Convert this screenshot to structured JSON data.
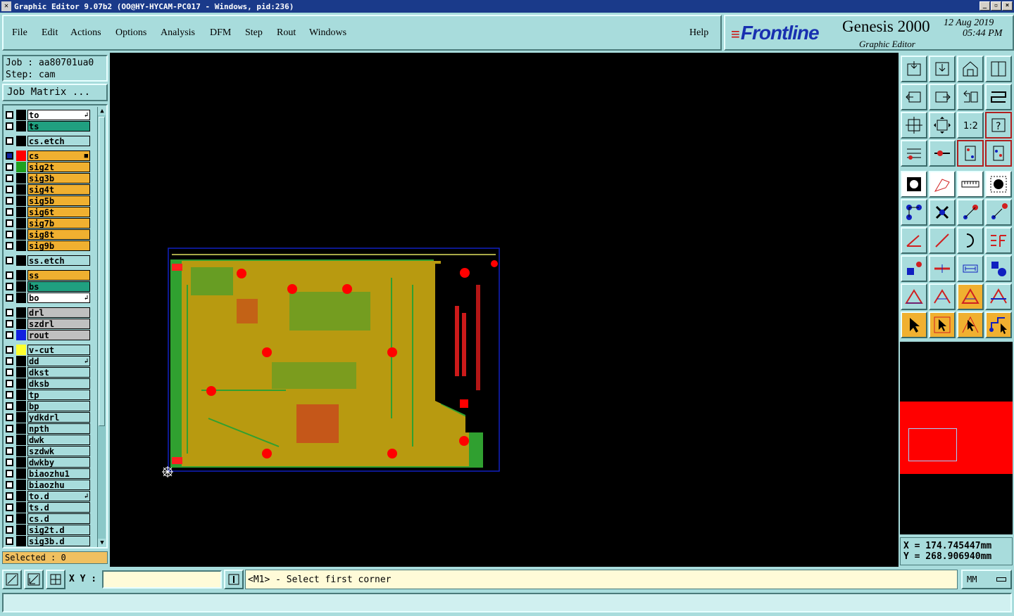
{
  "window": {
    "title": "Graphic Editor 9.07b2  (OO@HY-HYCAM-PC017 - Windows, pid:236)",
    "icon": "close-x-icon"
  },
  "menu": {
    "items": [
      "File",
      "Edit",
      "Actions",
      "Options",
      "Analysis",
      "DFM",
      "Step",
      "Rout",
      "Windows"
    ],
    "help": "Help"
  },
  "logo": {
    "brand": "Frontline",
    "product": "Genesis 2000",
    "subtitle": "Graphic Editor",
    "date": "12 Aug 2019",
    "time": "05:44 PM"
  },
  "job": {
    "job_line": "Job : aa80701ua0",
    "step_line": "Step: cam",
    "matrix_button": "Job Matrix ..."
  },
  "layers": [
    {
      "name": "to",
      "swatch": "",
      "bg": "#ffffff",
      "mark": "↲"
    },
    {
      "name": "ts",
      "swatch": "",
      "bg": "#20a080",
      "mark": ""
    },
    {
      "name": "cs.etch",
      "swatch": "",
      "bg": "#a8dcdc",
      "mark": ""
    },
    {
      "name": "cs",
      "swatch": "#ff0000",
      "bg": "#f0b030",
      "mark": "■",
      "active": true
    },
    {
      "name": "sig2t",
      "swatch": "#20a020",
      "bg": "#f0b030",
      "mark": ""
    },
    {
      "name": "sig3b",
      "swatch": "",
      "bg": "#f0b030",
      "mark": ""
    },
    {
      "name": "sig4t",
      "swatch": "",
      "bg": "#f0b030",
      "mark": ""
    },
    {
      "name": "sig5b",
      "swatch": "",
      "bg": "#f0b030",
      "mark": ""
    },
    {
      "name": "sig6t",
      "swatch": "",
      "bg": "#f0b030",
      "mark": ""
    },
    {
      "name": "sig7b",
      "swatch": "",
      "bg": "#f0b030",
      "mark": ""
    },
    {
      "name": "sig8t",
      "swatch": "",
      "bg": "#f0b030",
      "mark": ""
    },
    {
      "name": "sig9b",
      "swatch": "",
      "bg": "#f0b030",
      "mark": ""
    },
    {
      "name": "ss.etch",
      "swatch": "",
      "bg": "#a8dcdc",
      "mark": ""
    },
    {
      "name": "ss",
      "swatch": "",
      "bg": "#f0b030",
      "mark": ""
    },
    {
      "name": "bs",
      "swatch": "",
      "bg": "#20a080",
      "mark": ""
    },
    {
      "name": "bo",
      "swatch": "",
      "bg": "#ffffff",
      "mark": "↲"
    },
    {
      "name": "drl",
      "swatch": "",
      "bg": "#c0c0c0",
      "mark": ""
    },
    {
      "name": "szdrl",
      "swatch": "",
      "bg": "#c0c0c0",
      "mark": ""
    },
    {
      "name": "rout",
      "swatch": "#1020e0",
      "bg": "#c0c0c0",
      "mark": ""
    },
    {
      "name": "v-cut",
      "swatch": "#ffff30",
      "bg": "#a8dcdc",
      "mark": ""
    },
    {
      "name": "dd",
      "swatch": "",
      "bg": "#a8dcdc",
      "mark": "↲"
    },
    {
      "name": "dkst",
      "swatch": "",
      "bg": "#a8dcdc",
      "mark": ""
    },
    {
      "name": "dksb",
      "swatch": "",
      "bg": "#a8dcdc",
      "mark": ""
    },
    {
      "name": "tp",
      "swatch": "",
      "bg": "#a8dcdc",
      "mark": ""
    },
    {
      "name": "bp",
      "swatch": "",
      "bg": "#a8dcdc",
      "mark": ""
    },
    {
      "name": "ydkdrl",
      "swatch": "",
      "bg": "#a8dcdc",
      "mark": ""
    },
    {
      "name": "npth",
      "swatch": "",
      "bg": "#a8dcdc",
      "mark": ""
    },
    {
      "name": "dwk",
      "swatch": "",
      "bg": "#a8dcdc",
      "mark": ""
    },
    {
      "name": "szdwk",
      "swatch": "",
      "bg": "#a8dcdc",
      "mark": ""
    },
    {
      "name": "dwkby",
      "swatch": "",
      "bg": "#a8dcdc",
      "mark": ""
    },
    {
      "name": "biaozhu1",
      "swatch": "",
      "bg": "#a8dcdc",
      "mark": ""
    },
    {
      "name": "biaozhu",
      "swatch": "",
      "bg": "#a8dcdc",
      "mark": ""
    },
    {
      "name": "to.d",
      "swatch": "",
      "bg": "#a8dcdc",
      "mark": "↲"
    },
    {
      "name": "ts.d",
      "swatch": "",
      "bg": "#a8dcdc",
      "mark": ""
    },
    {
      "name": "cs.d",
      "swatch": "",
      "bg": "#a8dcdc",
      "mark": ""
    },
    {
      "name": "sig2t.d",
      "swatch": "",
      "bg": "#a8dcdc",
      "mark": ""
    },
    {
      "name": "sig3b.d",
      "swatch": "",
      "bg": "#a8dcdc",
      "mark": ""
    }
  ],
  "selected": "Selected : 0",
  "coords": {
    "x": "X = 174.745447mm",
    "y": "Y = 268.906940mm"
  },
  "bottom": {
    "xy_label": "X Y :",
    "xy_value": "",
    "prompt": "<M1> - Select first corner",
    "units": "MM"
  },
  "colors": {
    "panel": "#a8dcdc",
    "board_copper": "#b89a10",
    "board_green": "#30a030",
    "pad_red": "#ff0000",
    "outline": "#1020c0"
  }
}
